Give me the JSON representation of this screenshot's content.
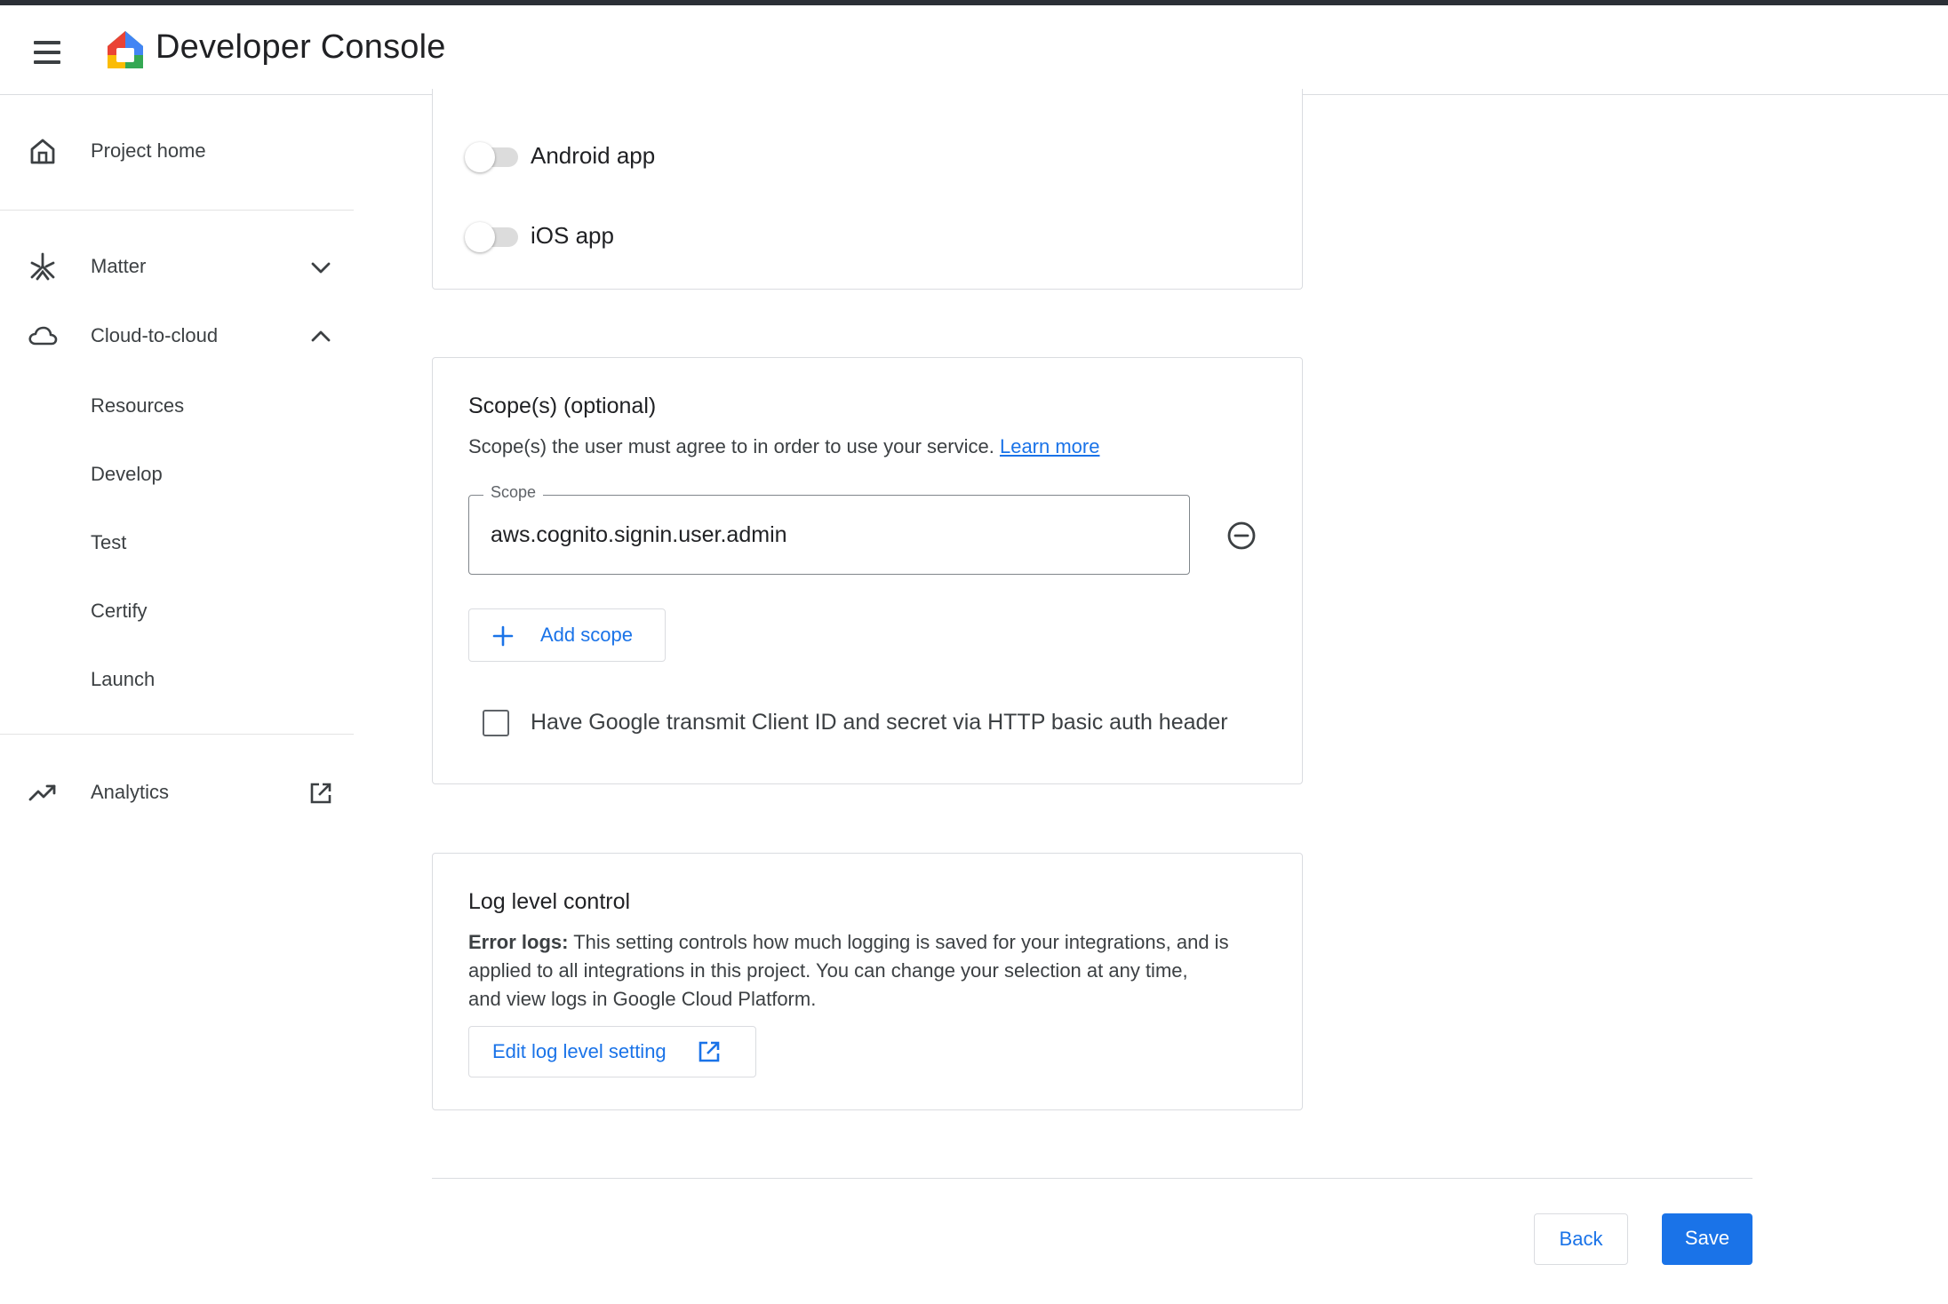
{
  "app": {
    "title": "Developer Console"
  },
  "sidebar": {
    "project_home": "Project home",
    "matter": "Matter",
    "cloud_to_cloud": "Cloud-to-cloud",
    "sub_items": [
      "Resources",
      "Develop",
      "Test",
      "Certify",
      "Launch"
    ],
    "analytics": "Analytics"
  },
  "platform_toggles": [
    {
      "label": "Android app",
      "enabled": false
    },
    {
      "label": "iOS app",
      "enabled": false
    }
  ],
  "scopes_section": {
    "title": "Scope(s) (optional)",
    "description": "Scope(s) the user must agree to in order to use your service.",
    "learn_more": "Learn more",
    "field_label": "Scope",
    "field_value": "aws.cognito.signin.user.admin",
    "add_scope_label": "Add scope",
    "basic_auth_label": "Have Google transmit Client ID and secret via HTTP basic auth header",
    "basic_auth_checked": false
  },
  "log_section": {
    "title": "Log level control",
    "desc_bold": "Error logs:",
    "desc_line1": "This setting controls how much logging is saved for your integrations, and is",
    "desc_line2": "applied to all integrations in this project. You can change your selection at any time,",
    "desc_line3": "and view logs in Google Cloud Platform.",
    "edit_button": "Edit log level setting"
  },
  "footer": {
    "back_label": "Back",
    "save_label": "Save"
  },
  "colors": {
    "accent": "#1a73e8",
    "border": "#dadce0",
    "text": "#202124"
  },
  "icons": [
    "menu-icon",
    "google-home-logo",
    "home-icon",
    "matter-icon",
    "cloud-icon",
    "chevron-down-icon",
    "chevron-up-icon",
    "analytics-icon",
    "open-in-new-icon",
    "remove-circle-icon",
    "add-icon"
  ]
}
